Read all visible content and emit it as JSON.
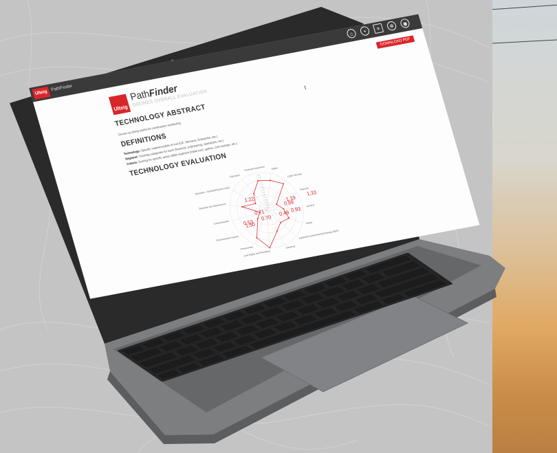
{
  "app": {
    "brand_mark": "Ulteig",
    "brand_name": "PathFinder",
    "nav_icons": [
      "home-icon",
      "plus-icon",
      "document-icon",
      "gear-icon",
      "user-icon"
    ],
    "download_label": "DOWNLOAD PDF"
  },
  "header": {
    "logo": "Ulteig",
    "title_plain": "Path",
    "title_bold": "Finder",
    "subtitle": "DRONES OVERALL EVALUATION"
  },
  "sections": {
    "abstract_title": "TECHNOLOGY ABSTRACT",
    "abstract_text": "Drones as being useful for construction monitoring.",
    "definitions_title": "DEFINITIONS",
    "def_technology_label": "Technology:",
    "def_technology_text": "Specific makes/models of tool (GE, Siemens, Enterprise, etc.)",
    "def_segment_label": "Segment:",
    "def_segment_text": "Tracking categories for each (financial, engineering, operations, etc.)",
    "def_criteria_label": "Criteria:",
    "def_criteria_text": "Scoring for specific areas within segment (initial cost, uptime, cost savings, etc.)",
    "evaluation_title": "TECHNOLOGY EVALUATION"
  },
  "chart_data": {
    "type": "radar",
    "categories": [
      "Financial Investment",
      "Safety",
      "Cyber Security",
      "Financial",
      "General",
      "Safety",
      "Equipment Environmental Ratings (EER)",
      "Electrical",
      "Land Rights and Permitting",
      "Procurement",
      "Environmental Impacts",
      "Communication",
      "Operation and Maintenance",
      "Education - Societal/Physical Costs",
      "Education"
    ],
    "values": [
      1.19,
      1.22,
      1.33,
      0.49,
      0.7,
      0.93,
      0.71,
      0.89,
      1.5,
      1.22,
      0.53,
      0.3,
      1.0,
      0.5,
      0.8
    ],
    "ticks": [
      "0.1",
      "0.2",
      "0.3",
      "0.4",
      "0.5",
      "0.6",
      "0.7",
      "0.8",
      "0.9",
      "1.0",
      "1.1",
      "1.2",
      "1.3",
      "1.4"
    ],
    "labels_shown": [
      "1.22",
      "1.19",
      "1.33",
      "1.50",
      "0.89",
      "0.93",
      "0.49",
      "0.70",
      "0.53",
      "0.71"
    ],
    "rmax": 1.5,
    "series_color": "#d9262a"
  },
  "colors": {
    "accent": "#d9262a",
    "topbar": "#3a3a3a"
  }
}
